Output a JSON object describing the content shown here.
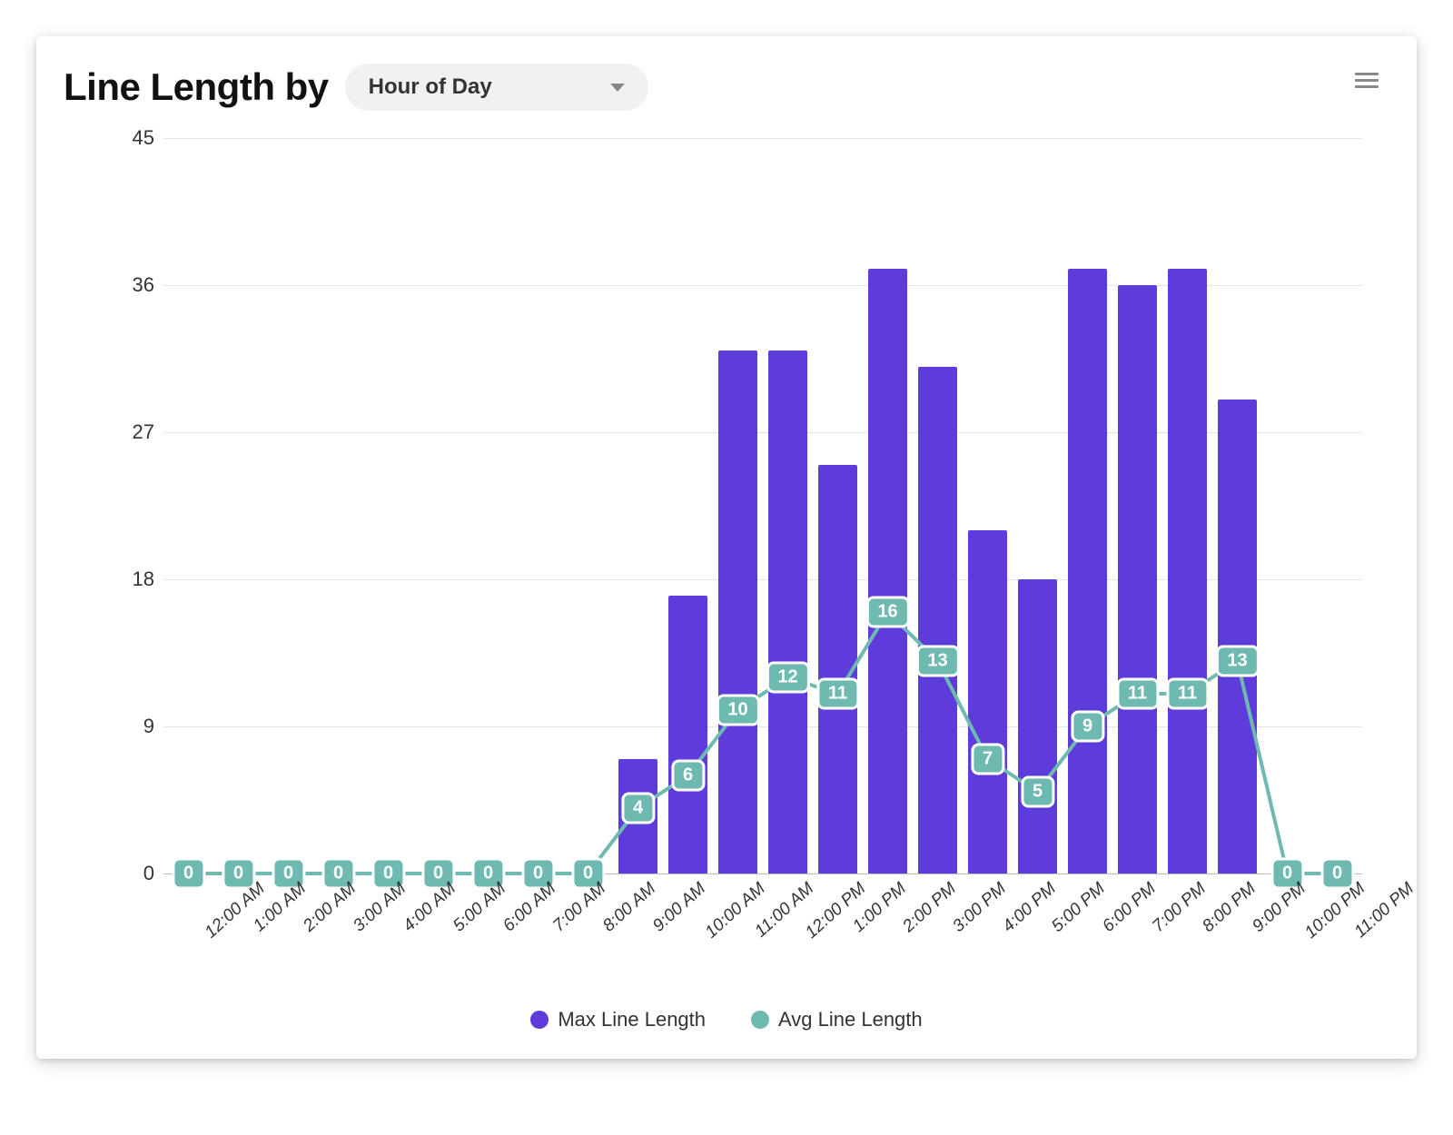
{
  "header": {
    "title": "Line Length by",
    "select_value": "Hour of Day"
  },
  "legend": {
    "series1": "Max Line Length",
    "series2": "Avg Line Length"
  },
  "colors": {
    "bar": "#5e3cdb",
    "line": "#6ebab0"
  },
  "chart_data": {
    "type": "bar",
    "title": "Line Length by Hour of Day",
    "xlabel": "",
    "ylabel": "",
    "ylim": [
      0,
      45
    ],
    "y_ticks": [
      0,
      9,
      18,
      27,
      36,
      45
    ],
    "categories": [
      "12:00 AM",
      "1:00 AM",
      "2:00 AM",
      "3:00 AM",
      "4:00 AM",
      "5:00 AM",
      "6:00 AM",
      "7:00 AM",
      "8:00 AM",
      "9:00 AM",
      "10:00 AM",
      "11:00 AM",
      "12:00 PM",
      "1:00 PM",
      "2:00 PM",
      "3:00 PM",
      "4:00 PM",
      "5:00 PM",
      "6:00 PM",
      "7:00 PM",
      "8:00 PM",
      "9:00 PM",
      "10:00 PM",
      "11:00 PM"
    ],
    "series": [
      {
        "name": "Max Line Length",
        "values": [
          0,
          0,
          0,
          0,
          0,
          0,
          0,
          0,
          0,
          7,
          17,
          32,
          32,
          25,
          37,
          31,
          21,
          18,
          37,
          36,
          37,
          29,
          0,
          0
        ]
      },
      {
        "name": "Avg Line Length",
        "values": [
          0,
          0,
          0,
          0,
          0,
          0,
          0,
          0,
          0,
          4,
          6,
          10,
          12,
          11,
          16,
          13,
          7,
          5,
          9,
          11,
          11,
          13,
          0,
          0
        ]
      }
    ]
  }
}
